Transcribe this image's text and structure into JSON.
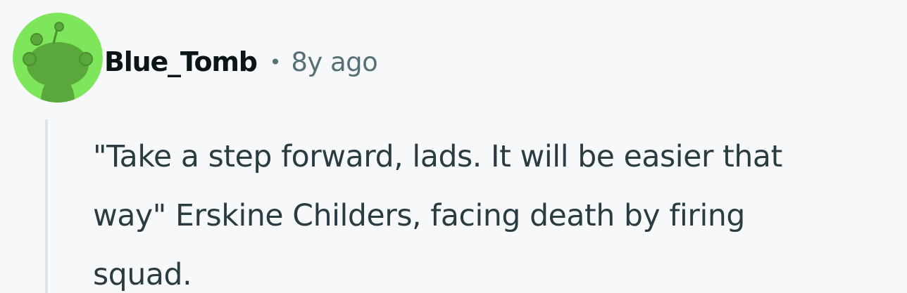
{
  "comment": {
    "avatar_icon": "snoo-avatar-icon",
    "avatar_color": "#7ee65a",
    "author": "Blue_Tomb",
    "separator": "•",
    "timestamp": "8y ago",
    "body": "\"Take a step forward, lads. It will be easier that\nway\" Erskine Childers, facing death by firing\nsquad."
  },
  "colors": {
    "background": "#f6f8f9",
    "author_text": "#0b1416",
    "meta_text": "#576f76",
    "body_text": "#2a3c42",
    "thread_line": "#dbe4e9"
  }
}
